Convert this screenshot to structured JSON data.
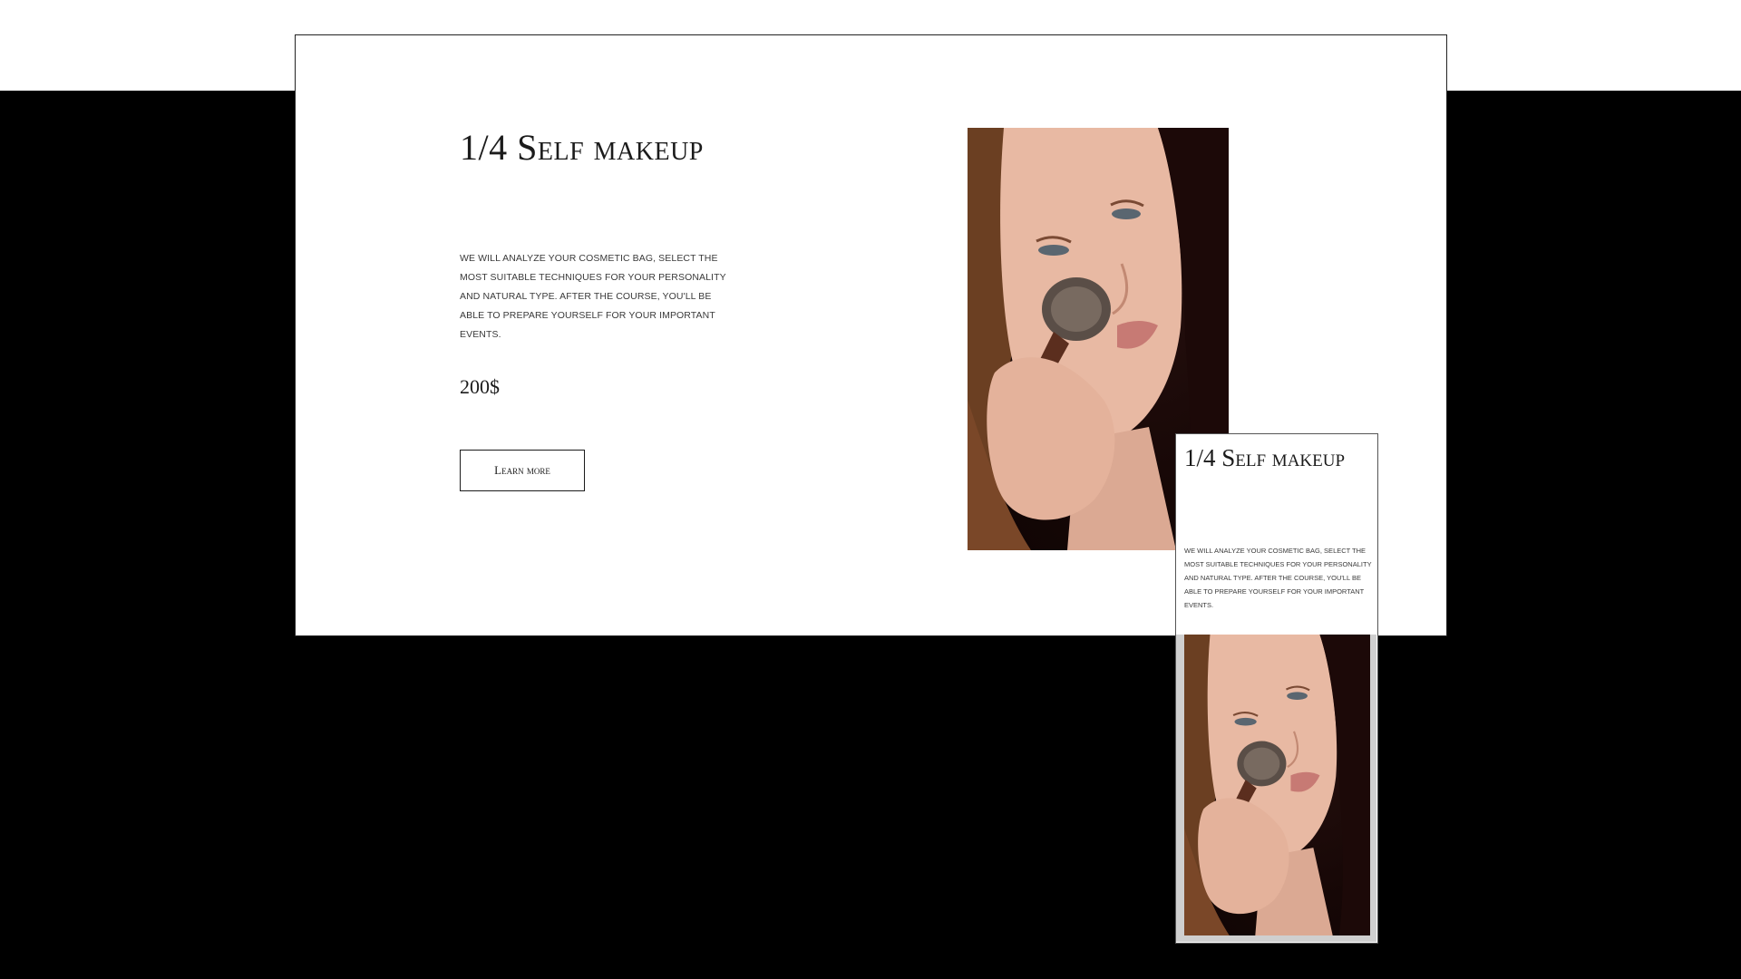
{
  "desktop": {
    "title": "1/4 Self makeup",
    "description": "We will analyze your cosmetic bag, select the most suitable techniques for your personality and natural type. After the course, you'll be able to prepare yourself for your important events.",
    "price": "200$",
    "button_label": "Learn more"
  },
  "mobile": {
    "title": "1/4 Self makeup",
    "description": "We will analyze your cosmetic bag, select the most suitable techniques for your personality and natural type. After the course, you'll be able to prepare yourself for your important events."
  },
  "colors": {
    "background_dark": "#000000",
    "card": "#ffffff",
    "text": "#1b1b1b"
  },
  "icons": {
    "photo": "woman-applying-makeup-photo"
  }
}
